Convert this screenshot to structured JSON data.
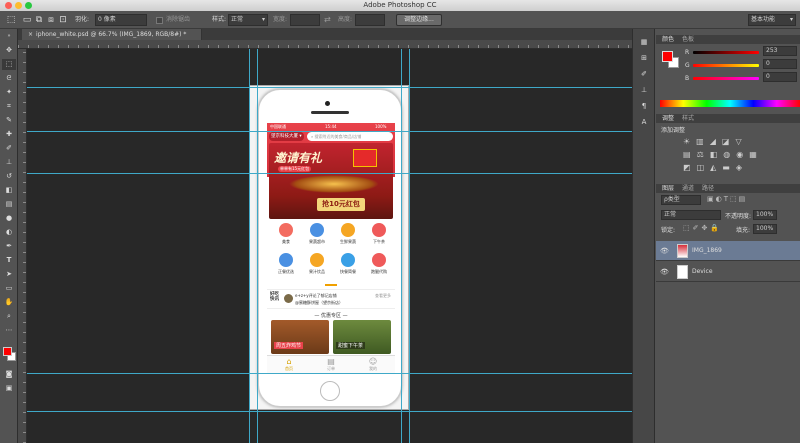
{
  "app_title": "Adobe Photoshop CC",
  "options": {
    "feather_label": "羽化:",
    "feather_value": "0 像素",
    "antialias_label": "消除锯齿",
    "style_label": "样式:",
    "style_value": "正常",
    "width_label": "宽度:",
    "height_label": "高度:",
    "refine_edge": "调整边缘...",
    "workspace": "基本功能"
  },
  "document_tab": "iphone_white.psd @ 66.7% (IMG_1869, RGB/8#) *",
  "color_panel": {
    "tab_color": "颜色",
    "tab_swatches": "色板",
    "r_value": "253",
    "g_value": "0",
    "b_value": "0",
    "foreground": "#fd0000"
  },
  "adjust_panel": {
    "tab_adjust": "调整",
    "tab_style": "样式",
    "add_label": "添加调整"
  },
  "layers_panel": {
    "tab_layers": "图层",
    "tab_channels": "通道",
    "tab_paths": "路径",
    "kind_label": "ρ类型",
    "blend_mode": "正常",
    "opacity_label": "不透明度:",
    "opacity_value": "100%",
    "lock_label": "锁定:",
    "fill_label": "填充:",
    "fill_value": "100%",
    "layers": [
      {
        "name": "IMG_1869",
        "selected": true
      },
      {
        "name": "Device",
        "selected": false
      }
    ]
  },
  "phone_app": {
    "status_carrier": "中国联通",
    "status_time": "15:44",
    "status_battery": "100%",
    "location": "望京科技大厦",
    "search_placeholder": "搜索附近的美食/商品/店铺",
    "banner_title": "邀请有礼",
    "banner_sub": "单单有15元红包",
    "coupon_text": "抢10元红包",
    "categories": [
      "美食",
      "果蔬超市",
      "生鲜果蔬",
      "下午茶",
      "正餐优选",
      "果汁饮品",
      "快餐简餐",
      "跑腿代购"
    ],
    "news_title": "好吃\n快讯",
    "news_line1": "e+z+y评论了郁记店铺",
    "news_line2": "@蜜糖酥饼屋（望京街店）",
    "news_more": "查看更多",
    "section_title": "— 优惠专区 —",
    "promo1": "周五炸鸡节",
    "promo2": "甜蜜下午茶",
    "tabs": [
      "首页",
      "订单",
      "我的"
    ]
  }
}
